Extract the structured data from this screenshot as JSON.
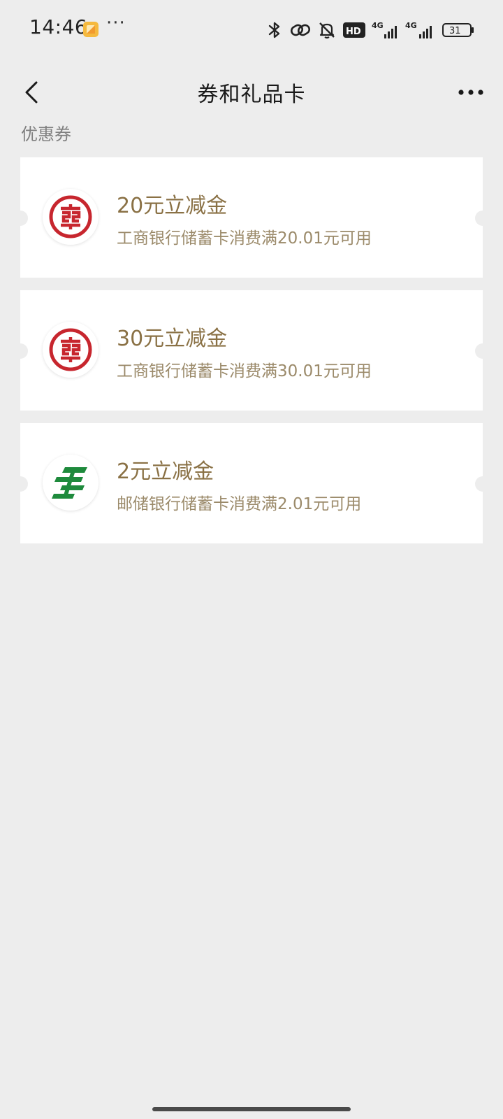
{
  "status_bar": {
    "time": "14:46",
    "more": "···",
    "battery": "31",
    "network_1": "4G",
    "network_2": "4G",
    "hd_badge": "HD",
    "icons": [
      "notification-app-icon",
      "bluetooth-icon",
      "link-icon",
      "mute-bell-icon",
      "hd-icon",
      "signal-icon",
      "battery-icon"
    ]
  },
  "nav": {
    "title": "券和礼品卡",
    "back_icon": "chevron-left-icon",
    "more_icon": "more-dots-icon"
  },
  "section": {
    "label": "优惠券"
  },
  "coupons": [
    {
      "title": "20元立减金",
      "desc": "工商银行储蓄卡消费满20.01元可用",
      "bank_logo": "icbc-logo",
      "logo_color": "#c7262e"
    },
    {
      "title": "30元立减金",
      "desc": "工商银行储蓄卡消费满30.01元可用",
      "bank_logo": "icbc-logo",
      "logo_color": "#c7262e"
    },
    {
      "title": "2元立减金",
      "desc": "邮储银行储蓄卡消费满2.01元可用",
      "bank_logo": "psbc-logo",
      "logo_color": "#1e8a3c"
    }
  ],
  "colors": {
    "background": "#ededed",
    "card": "#ffffff",
    "coupon_title": "#8a7145",
    "coupon_desc": "#9b8a6a",
    "section_label": "#7f7f7f"
  }
}
